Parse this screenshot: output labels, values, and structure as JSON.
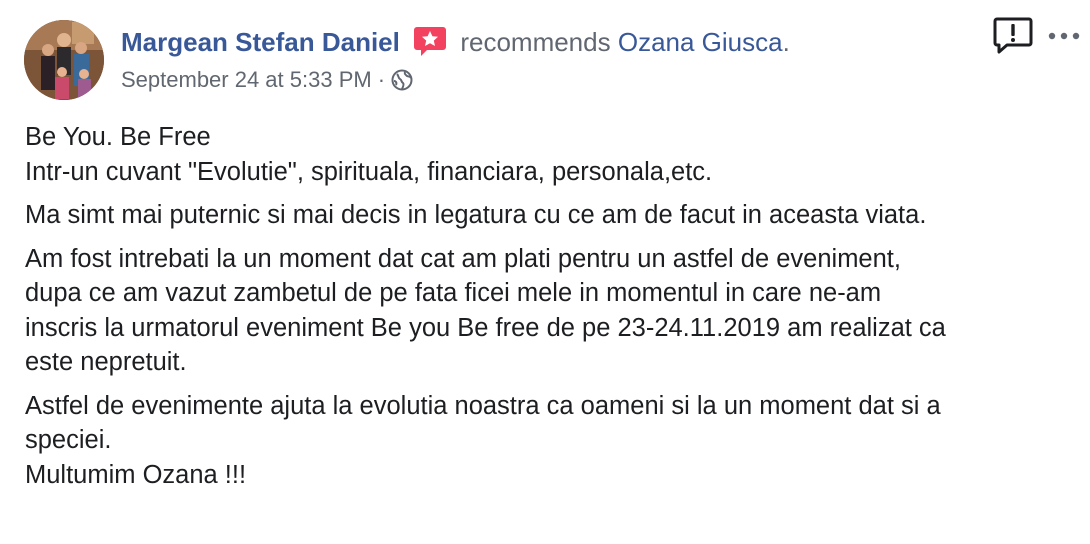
{
  "post": {
    "author_name": "Margean Stefan Daniel",
    "verb": "recommends",
    "target_page": "Ozana Giusca",
    "period": ".",
    "timestamp": "September 24 at 5:33 PM",
    "separator": "·",
    "privacy": "public",
    "icons": {
      "badge": "recommendation-badge-icon",
      "privacy": "globe-icon",
      "report": "report-icon",
      "more": "more-options-icon"
    },
    "colors": {
      "link": "#385898",
      "meta": "#616770",
      "badge": "#f3425f"
    },
    "paragraphs": [
      {
        "lines": [
          "Be You. Be Free",
          "Intr-un cuvant \"Evolutie\", spirituala, financiara, personala,etc."
        ]
      },
      {
        "lines": [
          "Ma simt mai puternic si mai decis in legatura cu ce am de facut in aceasta viata."
        ]
      },
      {
        "lines": [
          "Am fost intrebati la un moment dat cat am plati pentru un astfel de eveniment,",
          "dupa ce am vazut zambetul de pe fata ficei mele in momentul in care ne-am",
          "inscris la urmatorul eveniment Be you Be free de pe 23-24.11.2019 am realizat ca",
          "este nepretuit."
        ]
      },
      {
        "lines": [
          "Astfel de evenimente ajuta la evolutia noastra ca oameni si la un moment dat si a",
          "speciei.",
          "Multumim Ozana !!!"
        ]
      }
    ]
  }
}
